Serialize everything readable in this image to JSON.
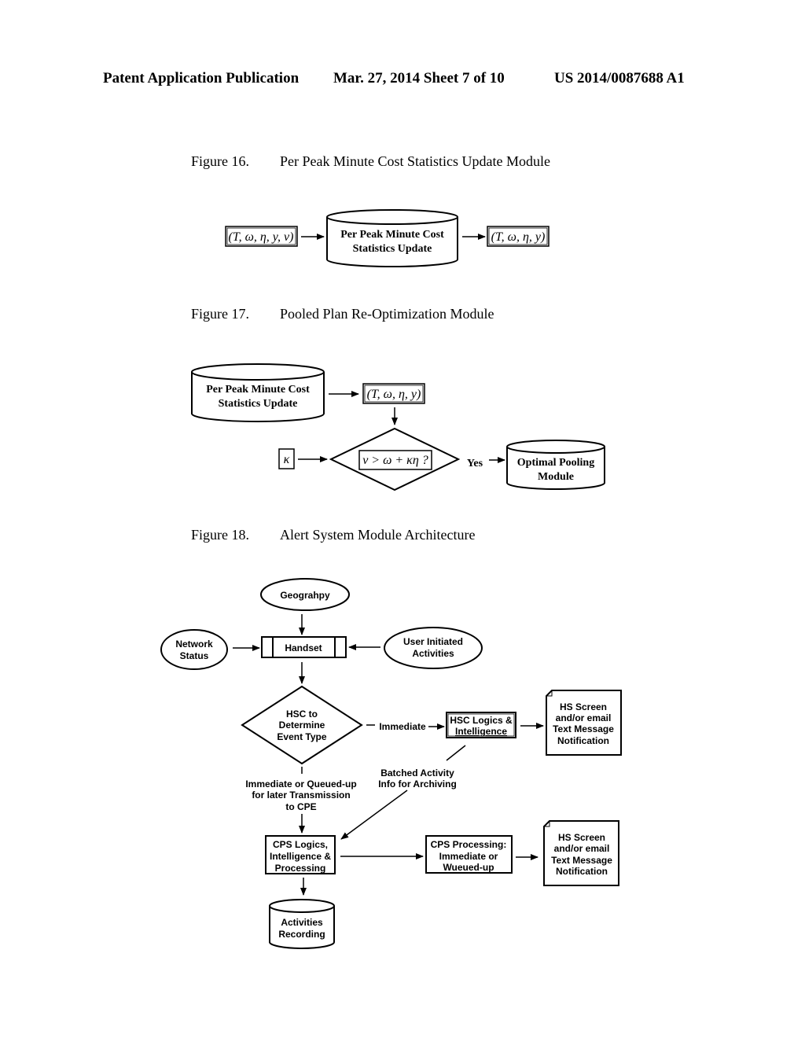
{
  "header": {
    "publication": "Patent Application Publication",
    "date_sheet": "Mar. 27, 2014  Sheet 7 of 10",
    "number": "US 2014/0087688 A1"
  },
  "fig16": {
    "label": "Figure 16.",
    "title": "Per Peak Minute Cost Statistics Update Module",
    "input": "(T, ω, η, y, v)",
    "module_line1": "Per Peak Minute Cost",
    "module_line2": "Statistics Update",
    "output": "(T, ω, η, y)"
  },
  "fig17": {
    "label": "Figure 17.",
    "title": "Pooled Plan Re-Optimization Module",
    "source_line1": "Per Peak Minute Cost",
    "source_line2": "Statistics Update",
    "stats": "(T, ω, η, y)",
    "kappa": "κ",
    "condition": "v > ω + κη ?",
    "yes": "Yes",
    "target_line1": "Optimal Pooling",
    "target_line2": "Module"
  },
  "fig18": {
    "label": "Figure 18.",
    "title": "Alert System Module Architecture",
    "geography": "Geograhpy",
    "network_line1": "Network",
    "network_line2": "Status",
    "handset": "Handset",
    "user_line1": "User Initiated",
    "user_line2": "Activities",
    "decision_line1": "HSC to",
    "decision_line2": "Determine",
    "decision_line3": "Event Type",
    "immediate": "Immediate",
    "hsc_line1": "HSC Logics &",
    "hsc_line2": "Intelligence",
    "notif1_line1": "HS Screen",
    "notif1_line2": "and/or email",
    "notif1_line3": "Text Message",
    "notif1_line4": "Notification",
    "queued_line1": "Immediate or Queued-up",
    "queued_line2": "for later Transmission",
    "queued_line3": "to CPE",
    "batched_line1": "Batched Activity",
    "batched_line2": "Info for Archiving",
    "cps_line1": "CPS Logics,",
    "cps_line2": "Intelligence &",
    "cps_line3": "Processing",
    "cpsproc_line1": "CPS Processing:",
    "cpsproc_line2": "Immediate or",
    "cpsproc_line3": "Wueued-up",
    "notif2_line1": "HS Screen",
    "notif2_line2": "and/or email",
    "notif2_line3": "Text Message",
    "notif2_line4": "Notification",
    "recording_line1": "Activities",
    "recording_line2": "Recording"
  }
}
